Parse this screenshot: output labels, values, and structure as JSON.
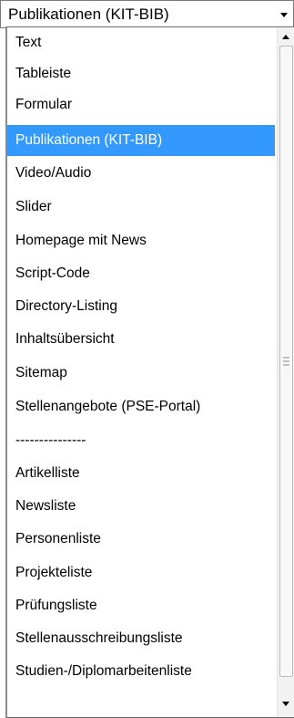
{
  "select": {
    "value": "Publikationen (KIT-BIB)",
    "arrow_icon": "chevron-down-icon"
  },
  "dropdown": {
    "options": [
      {
        "label": "Text",
        "selected": false
      },
      {
        "label": "Tableiste",
        "selected": false
      },
      {
        "label": "Formular",
        "selected": false
      },
      {
        "label": "Publikationen (KIT-BIB)",
        "selected": true
      },
      {
        "label": "Video/Audio",
        "selected": false
      },
      {
        "label": "Slider",
        "selected": false
      },
      {
        "label": "Homepage mit News",
        "selected": false
      },
      {
        "label": "Script-Code",
        "selected": false
      },
      {
        "label": "Directory-Listing",
        "selected": false
      },
      {
        "label": "Inhaltsübersicht",
        "selected": false
      },
      {
        "label": "Sitemap",
        "selected": false
      },
      {
        "label": "Stellenangebote (PSE-Portal)",
        "selected": false
      },
      {
        "label": "---------------",
        "selected": false
      },
      {
        "label": "Artikelliste",
        "selected": false
      },
      {
        "label": "Newsliste",
        "selected": false
      },
      {
        "label": "Personenliste",
        "selected": false
      },
      {
        "label": "Projekteliste",
        "selected": false
      },
      {
        "label": "Prüfungsliste",
        "selected": false
      },
      {
        "label": "Stellenausschreibungsliste",
        "selected": false
      },
      {
        "label": "Studien-/Diplomarbeitenliste",
        "selected": false
      }
    ]
  },
  "scrollbar": {
    "up_icon": "arrow-up-icon",
    "down_icon": "arrow-down-icon",
    "grip_icon": "grip-icon"
  },
  "colors": {
    "selected_bg": "#3399ff",
    "selected_text": "#ffffff",
    "text": "#000000"
  }
}
